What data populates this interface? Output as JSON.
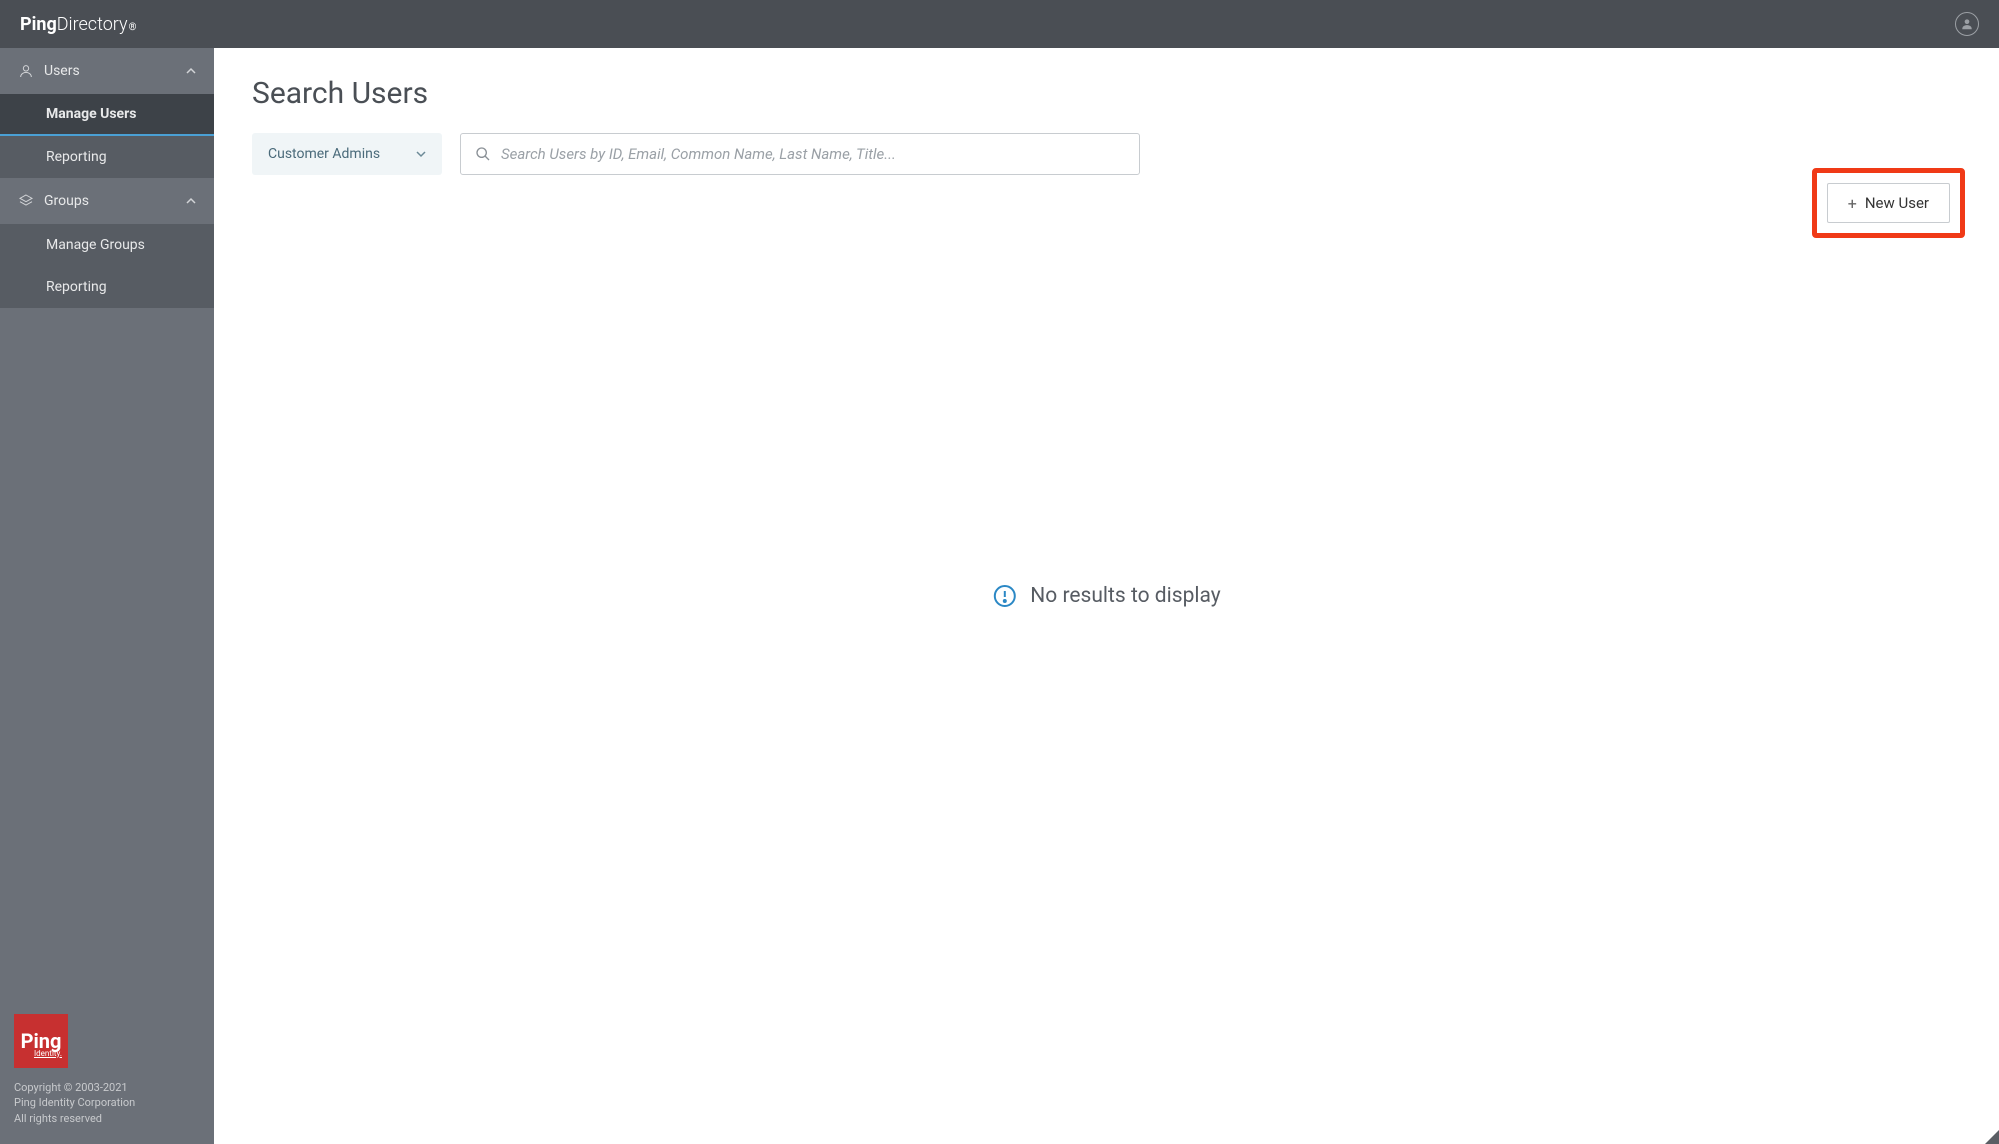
{
  "header": {
    "product_name_bold": "Ping",
    "product_name_light": "Directory",
    "product_name_reg": "®"
  },
  "sidebar": {
    "sections": [
      {
        "label": "Users",
        "items": [
          {
            "label": "Manage Users",
            "active": true
          },
          {
            "label": "Reporting",
            "active": false
          }
        ]
      },
      {
        "label": "Groups",
        "items": [
          {
            "label": "Manage Groups",
            "active": false
          },
          {
            "label": "Reporting",
            "active": false
          }
        ]
      }
    ],
    "footer": {
      "logo_big": "Ping",
      "logo_small": "Identity.",
      "copyright": "Copyright © 2003-2021",
      "company": "Ping Identity Corporation",
      "rights": "All rights reserved"
    }
  },
  "main": {
    "page_title": "Search Users",
    "filter_dropdown": {
      "selected": "Customer Admins"
    },
    "search": {
      "placeholder": "Search Users by ID, Email, Common Name, Last Name, Title..."
    },
    "new_user_button_label": "New User",
    "empty_state_text": "No results to display"
  }
}
